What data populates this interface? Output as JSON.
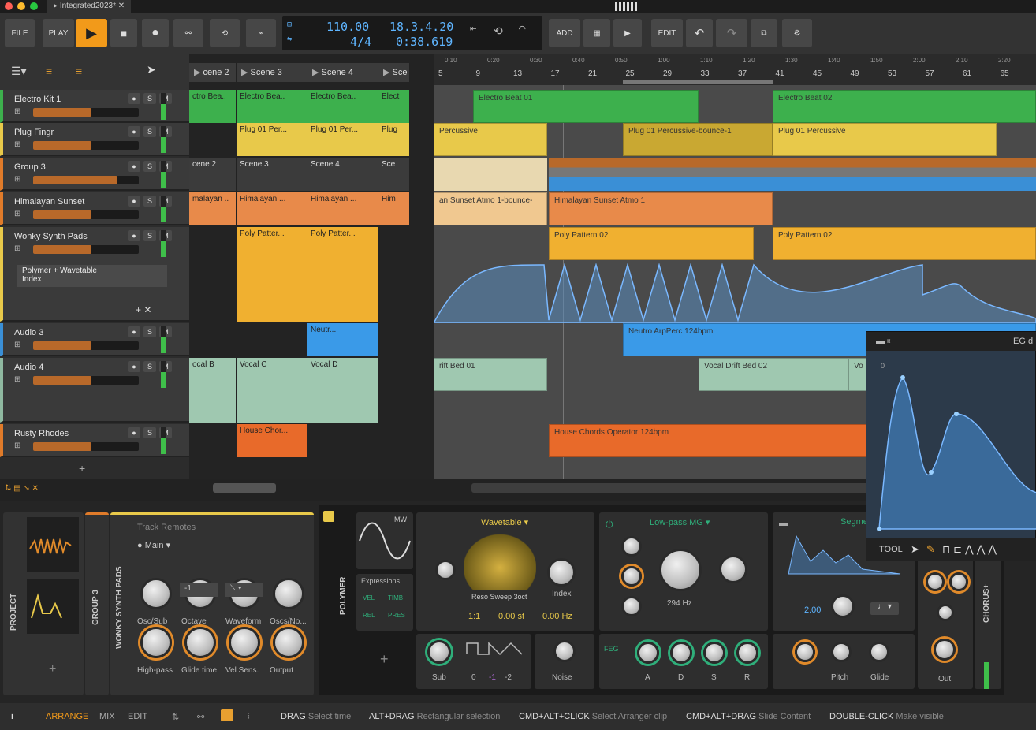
{
  "window": {
    "tab_title": "Integrated2023*"
  },
  "toolbar": {
    "file": "FILE",
    "play": "PLAY",
    "add": "ADD",
    "edit": "EDIT",
    "tempo": "110.00",
    "time_sig": "4/4",
    "position_bars": "18.3.4.20",
    "position_time": "0:38.619",
    "accent": "#f29a1a"
  },
  "tracks": [
    {
      "name": "Electro Kit 1",
      "color": "#3db04d",
      "level": 0.55
    },
    {
      "name": "Plug Fingr",
      "color": "#e8c94a",
      "level": 0.55
    },
    {
      "name": "Group 3",
      "color": "#e07b2a",
      "level": 0.8
    },
    {
      "name": "Himalayan Sunset",
      "color": "#e07b2a",
      "level": 0.55
    },
    {
      "name": "Wonky Synth Pads",
      "color": "#e8c94a",
      "level": 0.55
    },
    {
      "name": "Audio 3",
      "color": "#3a8fd6",
      "level": 0.55
    },
    {
      "name": "Audio 4",
      "color": "#8fb8a0",
      "level": 0.55
    },
    {
      "name": "Rusty Rhodes",
      "color": "#e07b2a",
      "level": 0.55
    }
  ],
  "device_chain_label": "Polymer + Wavetable",
  "device_chain_sub": "Index",
  "buttons": {
    "s": "S",
    "m": "M"
  },
  "scenes": [
    {
      "label": "cene 2"
    },
    {
      "label": "Scene 3"
    },
    {
      "label": "Scene 4"
    },
    {
      "label": "Sce"
    }
  ],
  "launcher_cells": {
    "electro": [
      "ctro Bea..",
      "Electro Bea..",
      "Electro Bea..",
      "Elect"
    ],
    "plug": [
      "Plug 01 Per...",
      "Plug 01 Per...",
      "Plug"
    ],
    "group_scenes": [
      "cene 2",
      "Scene 3",
      "Scene 4",
      "Sce"
    ],
    "himalayan": [
      "malayan ..",
      "Himalayan ...",
      "Himalayan ...",
      "Him"
    ],
    "poly": [
      "Poly Patter...",
      "Poly Patter..."
    ],
    "audio3": [
      "Neutr..."
    ],
    "audio4": [
      "ocal B",
      "Vocal C",
      "Vocal D"
    ],
    "rhodes": [
      "House Chor..."
    ]
  },
  "ruler": {
    "bars": [
      "5",
      "9",
      "13",
      "17",
      "21",
      "25",
      "29",
      "33",
      "37",
      "41",
      "45",
      "49",
      "53",
      "57",
      "61",
      "65"
    ],
    "times": [
      "0:10",
      "0:20",
      "0:30",
      "0:40",
      "0:50",
      "1:00",
      "1:10",
      "1:20",
      "1:30",
      "1:40",
      "1:50",
      "2:00",
      "2:10",
      "2:20"
    ]
  },
  "arranger_clips": {
    "electro_a": "Electro Beat 01",
    "electro_b": "Electro Beat 02",
    "perc_a": "Percussive",
    "perc_b": "Plug 01 Percussive-bounce-1",
    "perc_c": "Plug 01 Percussive",
    "sunset_a": "an Sunset Atmo 1-bounce-",
    "sunset_b": "Himalayan Sunset Atmo 1",
    "poly_a": "Poly Pattern 02",
    "poly_b": "Poly Pattern 02",
    "neutron": "Neutro ArpPerc 124bpm",
    "drift_a": "rift Bed 01",
    "drift_b": "Vocal Drift Bed 02",
    "drift_c": "Vo",
    "house": "House Chords Operator 124bpm"
  },
  "devices": {
    "project": "PROJECT",
    "group3": "GROUP 3",
    "wonky": "WONKY SYNTH PADS",
    "track_remotes": "Track Remotes",
    "main": "Main",
    "remote_labels": [
      "Osc/Sub",
      "Octave",
      "Waveform",
      "Oscs/No...",
      "High-pass",
      "Glide time",
      "Vel Sens.",
      "Output"
    ],
    "octave_value": "-1",
    "polymer": "POLYMER",
    "wavetable": "Wavetable",
    "expressions": "Expressions",
    "expr_labels": [
      "VEL",
      "TIMB",
      "REL",
      "PRES"
    ],
    "reso_sweep": "Reso Sweep 3oct",
    "index": "Index",
    "ratio": "1:1",
    "offset": "0.00 st",
    "hz": "0.00 Hz",
    "sub": "Sub",
    "sub_vals": [
      "0",
      "-1",
      "-2"
    ],
    "noise": "Noise",
    "filter": "Low-pass MG",
    "freq": "294 Hz",
    "adsr": [
      "A",
      "D",
      "S",
      "R"
    ],
    "feg": "FEG",
    "segments": "Segments",
    "seg_value": "2.00",
    "pitch": "Pitch",
    "glide": "Glide",
    "out": "Out",
    "chorus": "CHORUS+",
    "mw": "MW"
  },
  "popup": {
    "title": "EG d",
    "zero": "0",
    "tool": "TOOL"
  },
  "status": {
    "arrange": "ARRANGE",
    "mix": "MIX",
    "edit": "EDIT",
    "hints": [
      {
        "k": "DRAG",
        "v": "Select time"
      },
      {
        "k": "ALT+DRAG",
        "v": "Rectangular selection"
      },
      {
        "k": "CMD+ALT+CLICK",
        "v": "Select Arranger clip"
      },
      {
        "k": "CMD+ALT+DRAG",
        "v": "Slide Content"
      },
      {
        "k": "DOUBLE-CLICK",
        "v": "Make visible"
      }
    ]
  }
}
